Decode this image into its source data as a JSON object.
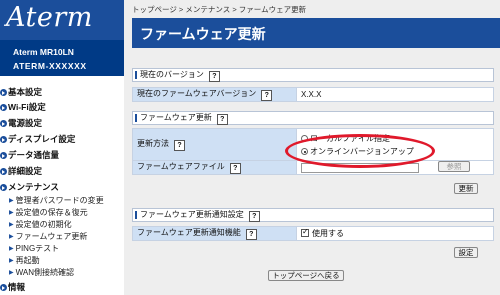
{
  "logo": "Aterm",
  "device": {
    "model": "Aterm   MR10LN",
    "ssid": "ATERM-XXXXXX"
  },
  "sidebar": {
    "top_items": [
      {
        "label": "基本設定"
      },
      {
        "label": "Wi-Fi設定"
      },
      {
        "label": "電源設定"
      },
      {
        "label": "ディスプレイ設定"
      },
      {
        "label": "データ通信量"
      },
      {
        "label": "詳細設定"
      },
      {
        "label": "メンテナンス"
      }
    ],
    "sub_items": [
      {
        "label": "管理者パスワードの変更"
      },
      {
        "label": "設定値の保存＆復元"
      },
      {
        "label": "設定値の初期化"
      },
      {
        "label": "ファームウェア更新"
      },
      {
        "label": "PINGテスト"
      },
      {
        "label": "再起動"
      },
      {
        "label": "WAN側接続確認"
      }
    ],
    "last_item": {
      "label": "情報"
    }
  },
  "breadcrumb": "トップページ > メンテナンス > ファームウェア更新",
  "page_title": "ファームウェア更新",
  "current_version": {
    "heading": "現在のバージョン",
    "row_label": "現在のファームウェアバージョン",
    "value": "X.X.X"
  },
  "firmware_update": {
    "heading": "ファームウェア更新",
    "method_label": "更新方法",
    "option_local": "ローカルファイル指定",
    "option_online": "オンラインバージョンアップ",
    "file_label": "ファームウェアファイル",
    "browse_button": "参照",
    "update_button": "更新"
  },
  "notification": {
    "heading": "ファームウェア更新通知設定",
    "row_label": "ファームウェア更新通知機能",
    "checkbox_label": "使用する",
    "set_button": "設定"
  },
  "footer_button": "トップページへ戻る",
  "help_glyph": "?",
  "colors": {
    "brand_blue": "#1b4e9b",
    "highlight_red": "#e0192b",
    "label_cell": "#cfe0f4"
  }
}
